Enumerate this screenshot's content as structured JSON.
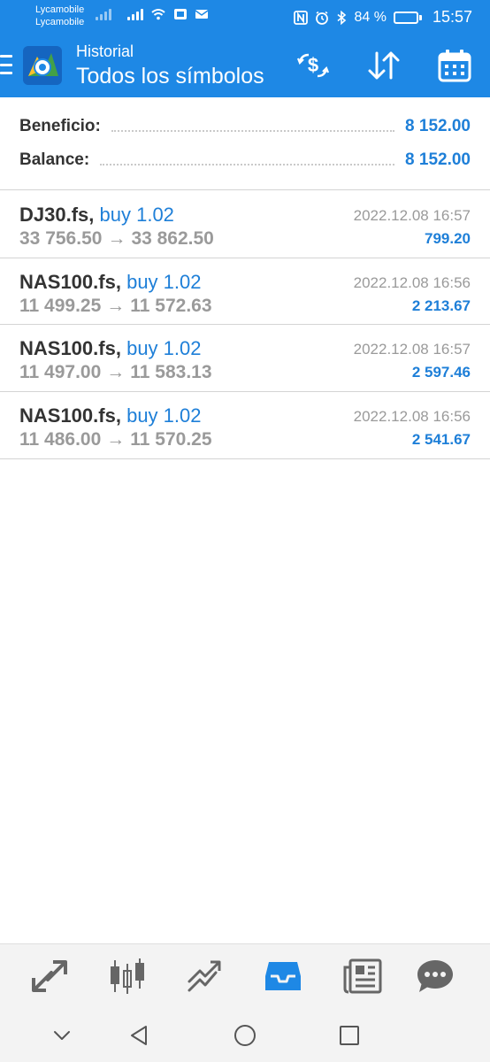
{
  "status_bar": {
    "carrier_1": "Lycamobile",
    "carrier_2": "Lycamobile",
    "battery": "84 %",
    "battery_level": 0.84,
    "time": "15:57",
    "icons": [
      "signal-icon",
      "signal-icon",
      "wifi-icon",
      "sim-icon",
      "mail-icon",
      "nfc-icon",
      "alarm-icon",
      "bluetooth-icon",
      "battery-icon"
    ]
  },
  "app_bar": {
    "subtitle": "Historial",
    "title": "Todos los símbolos",
    "actions": [
      "currency-exchange-icon",
      "sort-icon",
      "calendar-icon"
    ]
  },
  "summary": {
    "profit_label": "Beneficio:",
    "profit_value": "8 152.00",
    "balance_label": "Balance:",
    "balance_value": "8 152.00"
  },
  "deals": [
    {
      "symbol": "DJ30.fs,",
      "side": "buy 1.02",
      "open": "33 756.50",
      "arrow": "→",
      "close": "33 862.50",
      "time": "2022.12.08 16:57",
      "profit": "799.20"
    },
    {
      "symbol": "NAS100.fs,",
      "side": "buy 1.02",
      "open": "11 499.25",
      "arrow": "→",
      "close": "11 572.63",
      "time": "2022.12.08 16:56",
      "profit": "2 213.67"
    },
    {
      "symbol": "NAS100.fs,",
      "side": "buy 1.02",
      "open": "11 497.00",
      "arrow": "→",
      "close": "11 583.13",
      "time": "2022.12.08 16:57",
      "profit": "2 597.46"
    },
    {
      "symbol": "NAS100.fs,",
      "side": "buy 1.02",
      "open": "11 486.00",
      "arrow": "→",
      "close": "11 570.25",
      "time": "2022.12.08 16:56",
      "profit": "2 541.67"
    }
  ],
  "tabs": [
    {
      "icon": "quotes-icon",
      "active": false
    },
    {
      "icon": "chart-icon",
      "active": false
    },
    {
      "icon": "trade-icon",
      "active": false
    },
    {
      "icon": "history-icon",
      "active": true
    },
    {
      "icon": "news-icon",
      "active": false
    },
    {
      "icon": "chat-icon",
      "active": false
    }
  ],
  "nav": [
    "collapse-icon",
    "back-icon",
    "home-icon",
    "recents-icon"
  ],
  "colors": {
    "accent": "#1e88e5",
    "value_blue": "#1e7fd8",
    "text": "#333333",
    "muted": "#9a9a9a"
  }
}
